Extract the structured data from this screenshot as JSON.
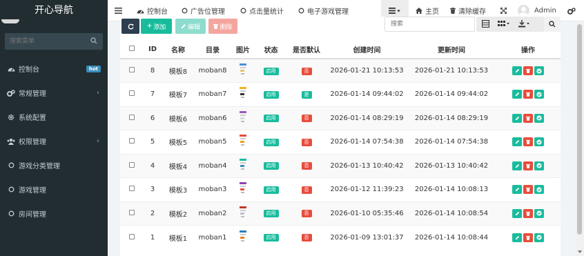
{
  "sidebar": {
    "title": "开心导航",
    "search_placeholder": "搜索菜单",
    "items": [
      {
        "label": "控制台",
        "icon": "dashboard-icon",
        "badge": "hot"
      },
      {
        "label": "常规管理",
        "icon": "cogs-icon",
        "chevron": "‹"
      },
      {
        "label": "系统配置",
        "icon": "gear-icon"
      },
      {
        "label": "权限管理",
        "icon": "users-icon",
        "chevron": "‹"
      },
      {
        "label": "游戏分类管理",
        "icon": "circle-icon"
      },
      {
        "label": "游戏管理",
        "icon": "circle-icon"
      },
      {
        "label": "房间管理",
        "icon": "circle-icon"
      }
    ]
  },
  "topnav": {
    "tabs": [
      {
        "label": "控制台",
        "icon": "dashboard-icon"
      },
      {
        "label": "广告位管理",
        "icon": "circle-icon"
      },
      {
        "label": "点击量统计",
        "icon": "circle-icon"
      },
      {
        "label": "电子游戏管理",
        "icon": "circle-icon"
      }
    ],
    "home_label": "主页",
    "clear_cache_label": "清除缓存",
    "user_label": "Admin"
  },
  "toolbar": {
    "add_label": "添加",
    "edit_label": "编辑",
    "delete_label": "删除",
    "search_placeholder": "搜索"
  },
  "table": {
    "headers": [
      "ID",
      "名称",
      "目录",
      "图片",
      "状态",
      "是否默认",
      "创建时间",
      "更新时间",
      "操作"
    ],
    "rows": [
      {
        "id": "8",
        "name": "模板8",
        "dir": "moban8",
        "status": "启用",
        "default": "否",
        "created": "2026-01-21 10:13:53",
        "updated": "2026-01-21 10:13:53",
        "default_color": "#e74c3c"
      },
      {
        "id": "7",
        "name": "模板7",
        "dir": "moban7",
        "status": "启用",
        "default": "是",
        "created": "2026-01-14 09:44:02",
        "updated": "2026-01-14 09:44:02",
        "default_color": "#18bc9c"
      },
      {
        "id": "6",
        "name": "模板6",
        "dir": "moban6",
        "status": "启用",
        "default": "否",
        "created": "2026-01-14 08:29:19",
        "updated": "2026-01-14 08:29:19",
        "default_color": "#e74c3c"
      },
      {
        "id": "5",
        "name": "模板5",
        "dir": "moban5",
        "status": "启用",
        "default": "否",
        "created": "2026-01-14 07:54:38",
        "updated": "2026-01-14 07:54:38",
        "default_color": "#e74c3c"
      },
      {
        "id": "4",
        "name": "模板4",
        "dir": "moban4",
        "status": "启用",
        "default": "否",
        "created": "2026-01-13 10:40:42",
        "updated": "2026-01-13 10:40:42",
        "default_color": "#e74c3c"
      },
      {
        "id": "3",
        "name": "模板3",
        "dir": "moban3",
        "status": "启用",
        "default": "否",
        "created": "2026-01-12 11:39:23",
        "updated": "2026-01-14 10:08:13",
        "default_color": "#e74c3c"
      },
      {
        "id": "2",
        "name": "模板2",
        "dir": "moban2",
        "status": "启用",
        "default": "否",
        "created": "2026-01-10 05:35:46",
        "updated": "2026-01-14 10:08:54",
        "default_color": "#e74c3c"
      },
      {
        "id": "1",
        "name": "模板1",
        "dir": "moban1",
        "status": "启用",
        "default": "否",
        "created": "2026-01-09 13:01:37",
        "updated": "2026-01-14 10:08:44",
        "default_color": "#e74c3c"
      }
    ]
  },
  "colors": {
    "sidebar_bg": "#222d32",
    "primary": "#18bc9c",
    "danger": "#e74c3c",
    "refresh": "#2c3e50",
    "badge": "#3c8dbc"
  }
}
